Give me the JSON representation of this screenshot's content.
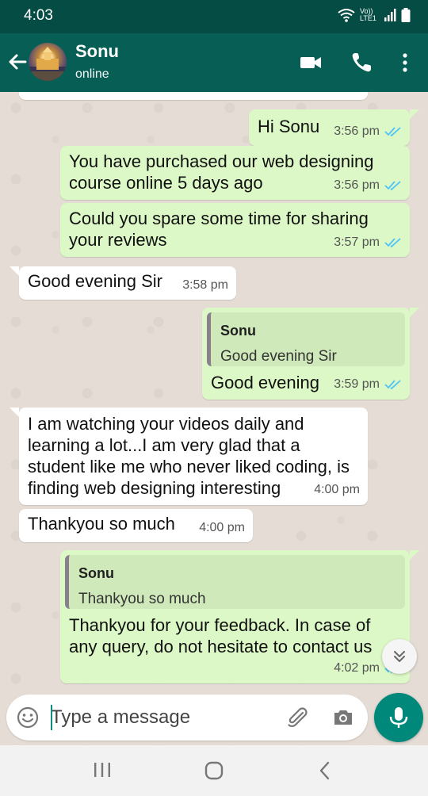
{
  "status_bar": {
    "time": "4:03",
    "network_label": "Vo)) LTE1"
  },
  "header": {
    "contact_name": "Sonu",
    "presence": "online"
  },
  "messages": [
    {
      "direction": "out",
      "text": "Hi Sonu",
      "time": "3:56 pm",
      "read": true
    },
    {
      "direction": "out",
      "text_lines": [
        "You have purchased our web designing",
        "course online 5 days ago"
      ],
      "time": "3:56 pm",
      "read": true
    },
    {
      "direction": "out",
      "text_lines": [
        "Could you spare some time for sharing",
        "your reviews"
      ],
      "time": "3:57 pm",
      "read": true
    },
    {
      "direction": "in",
      "text": "Good evening Sir",
      "time": "3:58 pm"
    },
    {
      "direction": "out",
      "quote": {
        "name": "Sonu",
        "text": "Good evening Sir"
      },
      "text": "Good evening",
      "time": "3:59 pm",
      "read": true
    },
    {
      "direction": "in",
      "text_lines": [
        "I am watching your videos daily and",
        "learning a lot...I am very glad that a",
        "student like me who never liked coding, is",
        "finding web designing interesting"
      ],
      "time": "4:00 pm"
    },
    {
      "direction": "in",
      "text": "Thankyou so much",
      "time": "4:00 pm"
    },
    {
      "direction": "out",
      "quote": {
        "name": "Sonu",
        "text": "Thankyou so much"
      },
      "text_lines": [
        "Thankyou for your feedback. In case of",
        "any query, do not hesitate to contact us"
      ],
      "time": "4:02 pm",
      "read": true
    }
  ],
  "input": {
    "placeholder": "Type a message",
    "value": ""
  },
  "colors": {
    "header": "#075e54",
    "status_bar": "#054d44",
    "outgoing_bubble": "#dcf8c6",
    "incoming_bubble": "#ffffff",
    "read_ticks": "#4fc3f7",
    "mic_button": "#00897b"
  },
  "icons": [
    "back-arrow-icon",
    "video-call-icon",
    "phone-icon",
    "more-options-icon",
    "emoji-icon",
    "attach-icon",
    "camera-icon",
    "mic-icon",
    "scroll-down-icon",
    "double-tick-icon",
    "recents-icon",
    "home-icon",
    "back-nav-icon"
  ]
}
